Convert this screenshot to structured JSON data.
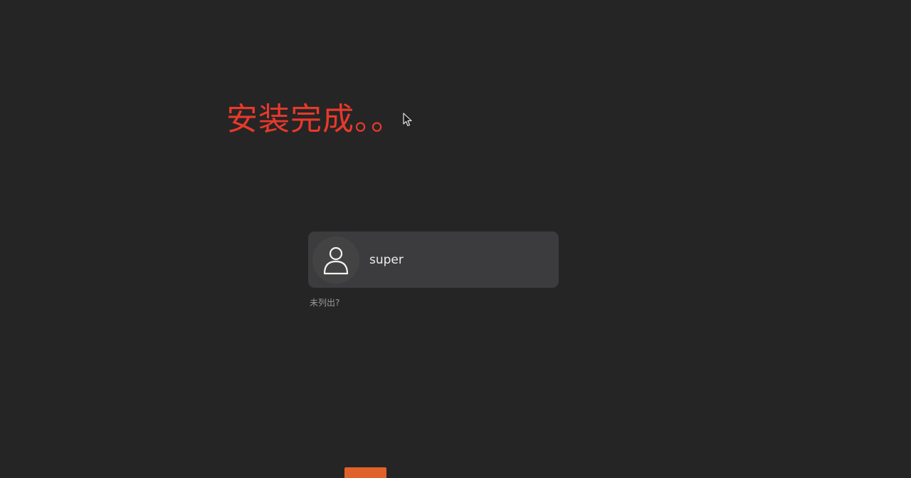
{
  "overlay": {
    "caption": "安装完成。。"
  },
  "login": {
    "users": [
      {
        "name": "super"
      }
    ],
    "not_listed_label": "未列出?"
  },
  "icons": {
    "avatar": "user-avatar-icon",
    "cursor": "mouse-pointer-icon"
  },
  "colors": {
    "background": "#252525",
    "caption": "#e8392b",
    "card": "#3c3c3e",
    "accent": "#e0622b"
  }
}
